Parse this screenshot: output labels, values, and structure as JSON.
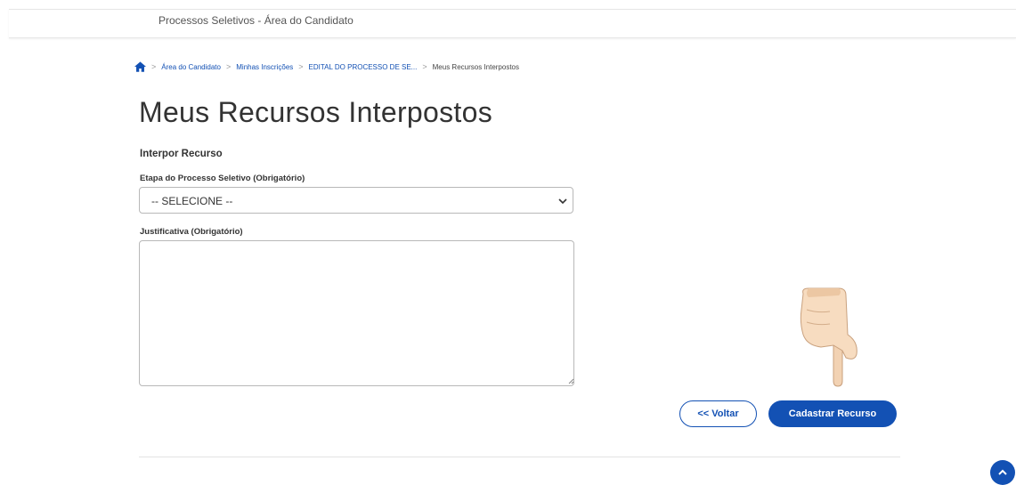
{
  "header": {
    "app_title": "Processos Seletivos - Área do Candidato"
  },
  "breadcrumb": {
    "home_icon": "home-icon",
    "items": [
      "Área do Candidato",
      "Minhas Inscrições",
      "EDITAL DO PROCESSO DE SE...",
      "Meus Recursos Interpostos"
    ]
  },
  "page": {
    "title": "Meus Recursos Interpostos",
    "section_title": "Interpor Recurso"
  },
  "form": {
    "etapa_label": "Etapa do Processo Seletivo (Obrigatório)",
    "etapa_selected": "-- SELECIONE --",
    "justificativa_label": "Justificativa (Obrigatório)",
    "justificativa_value": ""
  },
  "actions": {
    "back_label": "<< Voltar",
    "submit_label": "Cadastrar Recurso"
  },
  "colors": {
    "primary": "#1351b4"
  }
}
